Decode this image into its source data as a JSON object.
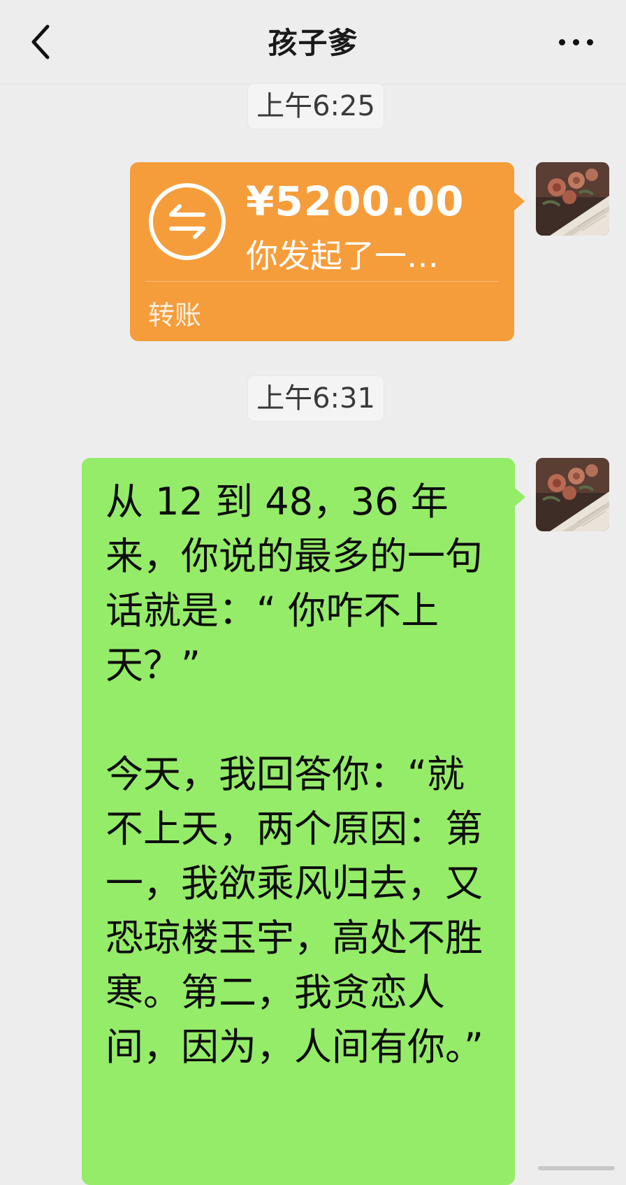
{
  "header": {
    "title": "孩子爹",
    "back_icon": "chevron-left-icon",
    "more_icon": "ellipsis-icon"
  },
  "messages": {
    "timestamp_1": "上午6:25",
    "transfer": {
      "amount": "¥5200.00",
      "description": "你发起了一…",
      "label": "转账",
      "icon": "transfer-arrows-icon",
      "color": "#f59d3b"
    },
    "timestamp_2": "上午6:31",
    "text_message": "从 12 到 48，36 年来，你说的最多的一句话就是：“ 你咋不上天？”\n\n今天，我回答你：“就不上天，两个原因：第一，我欲乘风归去，又恐琼楼玉宇，高处不胜寒。第二，我贪恋人间，因为，人间有你。”",
    "text_bubble_color": "#95ec69"
  },
  "avatar": {
    "icon": "flowers-book-avatar"
  }
}
